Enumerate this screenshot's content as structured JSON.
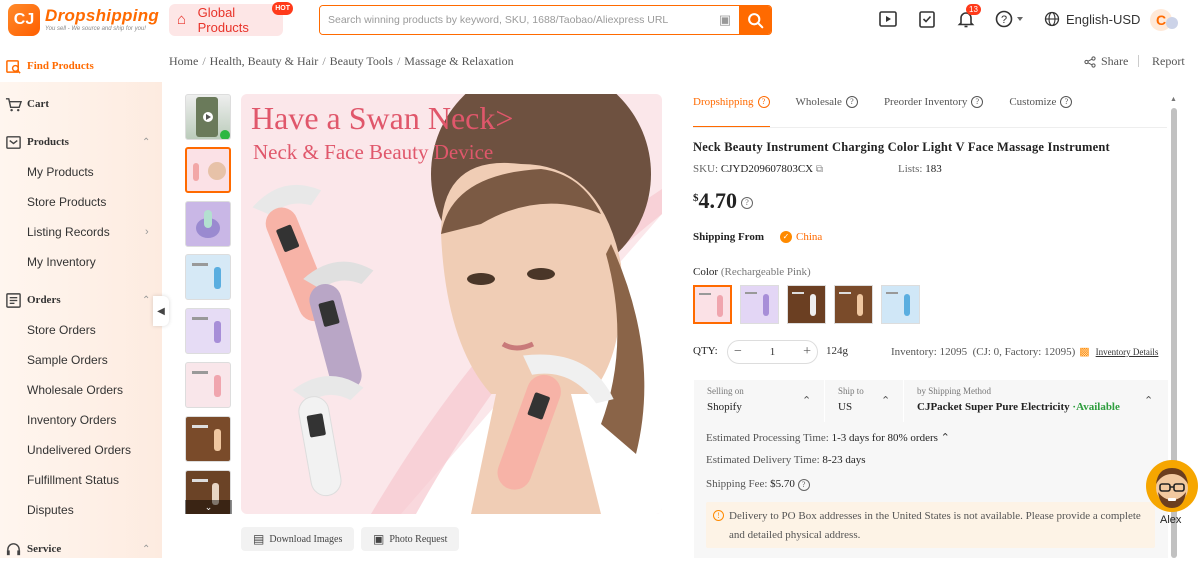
{
  "header": {
    "logo_mark": "CJ",
    "logo_title": "Dropshipping",
    "logo_tagline": "You sell - We source and ship for you!",
    "global_products_label": "Global Products",
    "hot_badge": "HOT",
    "search_placeholder": "Search winning products by keyword, SKU, 1688/Taobao/Aliexpress URL",
    "notification_count": "13",
    "language": "English-USD",
    "account_initial": "C"
  },
  "sidebar": {
    "sections": [
      {
        "label": "Find Products"
      },
      {
        "label": "Cart"
      },
      {
        "label": "Products"
      },
      {
        "label": "Orders"
      },
      {
        "label": "Service"
      }
    ],
    "product_items": [
      "My Products",
      "Store Products",
      "Listing Records",
      "My Inventory"
    ],
    "order_items": [
      "Store Orders",
      "Sample Orders",
      "Wholesale Orders",
      "Inventory Orders",
      "Undelivered Orders",
      "Fulfillment Status",
      "Disputes"
    ]
  },
  "breadcrumb": [
    "Home",
    "Health, Beauty & Hair",
    "Beauty Tools",
    "Massage & Relaxation"
  ],
  "actions": {
    "share": "Share",
    "report": "Report"
  },
  "gallery": {
    "headline": "Have a Swan Neck>",
    "subheadline": "Neck & Face Beauty Device",
    "download_images": "Download Images",
    "photo_request": "Photo Request"
  },
  "tabs": [
    "Dropshipping",
    "Wholesale",
    "Preorder Inventory",
    "Customize"
  ],
  "product": {
    "title": "Neck Beauty Instrument Charging Color Light V Face Massage Instrument",
    "sku_label": "SKU:",
    "sku": "CJYD209607803CX",
    "lists_label": "Lists:",
    "lists": "183",
    "currency": "$",
    "price": "4.70",
    "shipping_from_label": "Shipping From",
    "shipping_from": "China",
    "color_label": "Color",
    "color_selected": "(Rechargeable Pink)",
    "qty_label": "QTY:",
    "qty": "1",
    "weight": "124g",
    "inventory": "Inventory: 12095",
    "inventory_breakdown": "(CJ: 0, Factory: 12095)",
    "inventory_details": "Inventory Details"
  },
  "shipping": {
    "selling_on_label": "Selling on",
    "selling_on": "Shopify",
    "ship_to_label": "Ship to",
    "ship_to": "US",
    "method_label": "by Shipping Method",
    "method": "CJPacket Super Pure Electricity",
    "availability": "·Available",
    "processing_label": "Estimated Processing Time:",
    "processing": "1-3 days for 80% orders",
    "delivery_label": "Estimated Delivery Time:",
    "delivery": "8-23 days",
    "fee_label": "Shipping Fee:",
    "fee": "$5.70",
    "notice": "Delivery to PO Box addresses in the United States is not available. Please provide a complete and detailed physical address."
  },
  "support": {
    "name": "Alex"
  },
  "colors": {
    "accent": "#ff6a00",
    "headline_pink": "#e0576b",
    "available_green": "#2e9e3e"
  }
}
